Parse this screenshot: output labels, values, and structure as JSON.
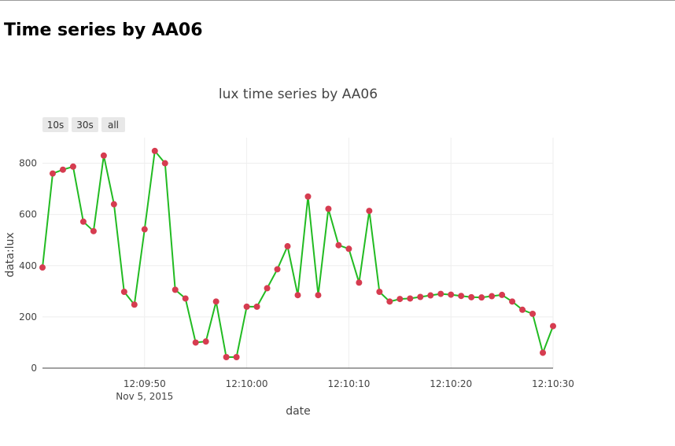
{
  "page": {
    "title": "Time series by AA06"
  },
  "range_buttons": [
    {
      "label": "10s"
    },
    {
      "label": "30s"
    },
    {
      "label": "all"
    }
  ],
  "colors": {
    "line": "#22bb22",
    "marker": "#d63c50",
    "grid": "#eeeeee",
    "axis": "#444444"
  },
  "chart_data": {
    "type": "line",
    "title": "lux time series by AA06",
    "xlabel": "date",
    "ylabel": "data:lux",
    "xlim": [
      "2015-11-05 12:09:40",
      "2015-11-05 12:10:30"
    ],
    "ylim": [
      0,
      900
    ],
    "x_ticks": [
      {
        "value": "2015-11-05 12:09:50",
        "label": "12:09:50",
        "sublabel": "Nov 5, 2015"
      },
      {
        "value": "2015-11-05 12:10:00",
        "label": "12:10:00"
      },
      {
        "value": "2015-11-05 12:10:10",
        "label": "12:10:10"
      },
      {
        "value": "2015-11-05 12:10:20",
        "label": "12:10:20"
      },
      {
        "value": "2015-11-05 12:10:30",
        "label": "12:10:30"
      }
    ],
    "y_ticks": [
      0,
      200,
      400,
      600,
      800
    ],
    "grid": true,
    "series": [
      {
        "x": [
          "2015-11-05 12:09:40",
          "2015-11-05 12:09:41",
          "2015-11-05 12:09:42",
          "2015-11-05 12:09:43",
          "2015-11-05 12:09:44",
          "2015-11-05 12:09:45",
          "2015-11-05 12:09:46",
          "2015-11-05 12:09:47",
          "2015-11-05 12:09:48",
          "2015-11-05 12:09:49",
          "2015-11-05 12:09:50",
          "2015-11-05 12:09:51",
          "2015-11-05 12:09:52",
          "2015-11-05 12:09:53",
          "2015-11-05 12:09:54",
          "2015-11-05 12:09:55",
          "2015-11-05 12:09:56",
          "2015-11-05 12:09:57",
          "2015-11-05 12:09:58",
          "2015-11-05 12:09:59",
          "2015-11-05 12:10:00",
          "2015-11-05 12:10:01",
          "2015-11-05 12:10:02",
          "2015-11-05 12:10:03",
          "2015-11-05 12:10:04",
          "2015-11-05 12:10:05",
          "2015-11-05 12:10:06",
          "2015-11-05 12:10:07",
          "2015-11-05 12:10:08",
          "2015-11-05 12:10:09",
          "2015-11-05 12:10:10",
          "2015-11-05 12:10:11",
          "2015-11-05 12:10:12",
          "2015-11-05 12:10:13",
          "2015-11-05 12:10:14",
          "2015-11-05 12:10:15",
          "2015-11-05 12:10:16",
          "2015-11-05 12:10:17",
          "2015-11-05 12:10:18",
          "2015-11-05 12:10:19",
          "2015-11-05 12:10:20",
          "2015-11-05 12:10:21",
          "2015-11-05 12:10:22",
          "2015-11-05 12:10:23",
          "2015-11-05 12:10:24",
          "2015-11-05 12:10:25",
          "2015-11-05 12:10:26",
          "2015-11-05 12:10:27",
          "2015-11-05 12:10:28",
          "2015-11-05 12:10:29",
          "2015-11-05 12:10:30"
        ],
        "values": [
          393,
          760,
          775,
          787,
          572,
          535,
          830,
          640,
          298,
          248,
          542,
          848,
          800,
          306,
          272,
          100,
          104,
          260,
          43,
          43,
          240,
          240,
          312,
          386,
          476,
          285,
          670,
          285,
          622,
          480,
          466,
          334,
          614,
          298,
          260,
          270,
          272,
          278,
          284,
          290,
          287,
          282,
          277,
          276,
          281,
          286,
          260,
          228,
          212,
          60,
          164
        ]
      }
    ]
  }
}
